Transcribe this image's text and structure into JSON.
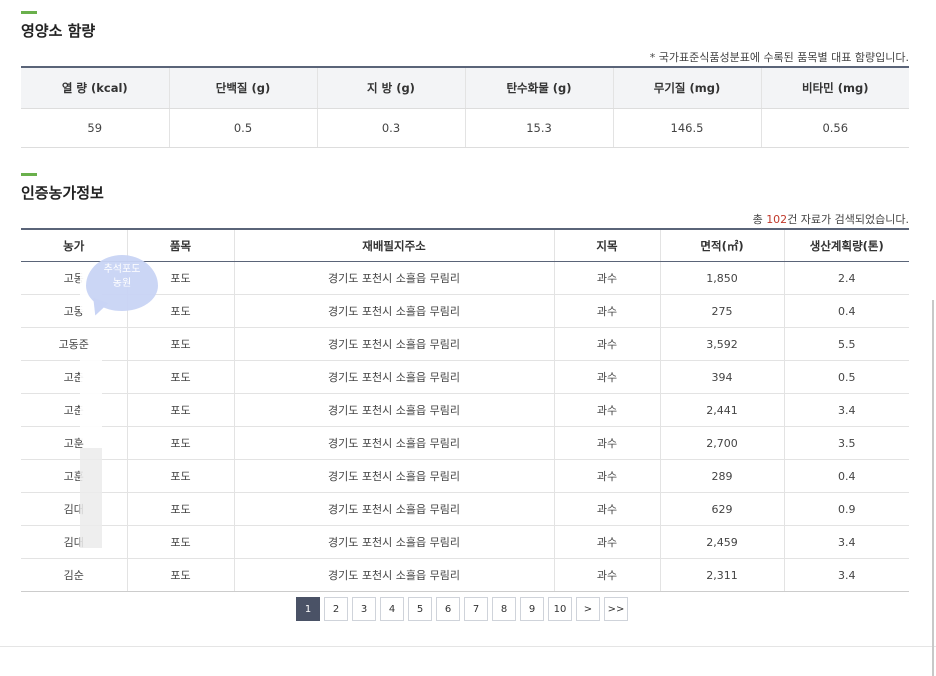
{
  "nutrition": {
    "title": "영양소 함량",
    "note": "* 국가표준식품성분표에 수록된 품목별 대표 함량입니다.",
    "headers": [
      "열 량 (kcal)",
      "단백질 (g)",
      "지 방 (g)",
      "탄수화물 (g)",
      "무기질 (mg)",
      "비타민 (mg)"
    ],
    "values": [
      "59",
      "0.5",
      "0.3",
      "15.3",
      "146.5",
      "0.56"
    ]
  },
  "farms": {
    "title": "인증농가정보",
    "count_prefix": "총 ",
    "count": "102",
    "count_suffix": "건 자료가 검색되었습니다.",
    "headers": [
      "농가",
      "품목",
      "재배필지주소",
      "지목",
      "면적(㎡)",
      "생산계획량(톤)"
    ],
    "rows": [
      [
        "고동",
        "포도",
        "경기도 포천시 소흘읍 무림리",
        "과수",
        "1,850",
        "2.4"
      ],
      [
        "고동",
        "포도",
        "경기도 포천시 소흘읍 무림리",
        "과수",
        "275",
        "0.4"
      ],
      [
        "고동준",
        "포도",
        "경기도 포천시 소흘읍 무림리",
        "과수",
        "3,592",
        "5.5"
      ],
      [
        "고춘",
        "포도",
        "경기도 포천시 소흘읍 무림리",
        "과수",
        "394",
        "0.5"
      ],
      [
        "고춘",
        "포도",
        "경기도 포천시 소흘읍 무림리",
        "과수",
        "2,441",
        "3.4"
      ],
      [
        "고훈",
        "포도",
        "경기도 포천시 소흘읍 무림리",
        "과수",
        "2,700",
        "3.5"
      ],
      [
        "고훈",
        "포도",
        "경기도 포천시 소흘읍 무림리",
        "과수",
        "289",
        "0.4"
      ],
      [
        "김대",
        "포도",
        "경기도 포천시 소흘읍 무림리",
        "과수",
        "629",
        "0.9"
      ],
      [
        "김대",
        "포도",
        "경기도 포천시 소흘읍 무림리",
        "과수",
        "2,459",
        "3.4"
      ],
      [
        "김순",
        "포도",
        "경기도 포천시 소흘읍 무림리",
        "과수",
        "2,311",
        "3.4"
      ]
    ]
  },
  "sticker": {
    "line1": "추석포도",
    "line2": "농원"
  },
  "pagination": {
    "pages": [
      "1",
      "2",
      "3",
      "4",
      "5",
      "6",
      "7",
      "8",
      "9",
      "10"
    ],
    "current": "1",
    "next": ">",
    "last": ">>"
  },
  "colors": {
    "accent": "#6ab04c",
    "header_rule": "#5a6478",
    "active_page": "#4a5266",
    "count_highlight": "#c0392b"
  }
}
